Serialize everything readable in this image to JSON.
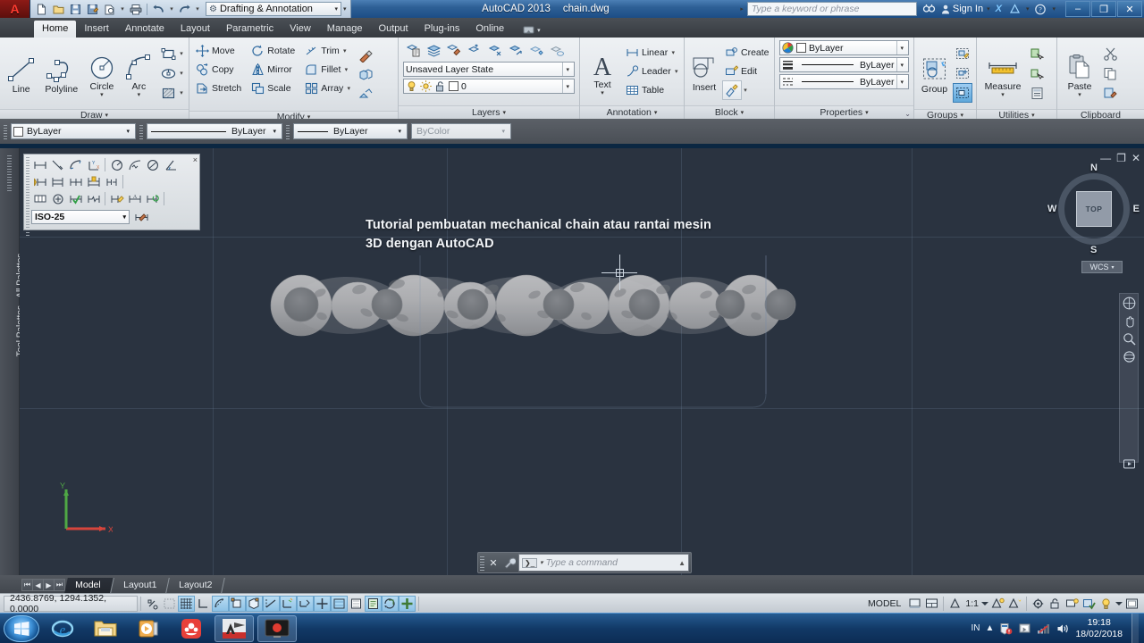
{
  "titlebar": {
    "app_icon": "autocad-a-icon",
    "quick_access": [
      {
        "name": "new-file",
        "glyph": "new-icon"
      },
      {
        "name": "open-file",
        "glyph": "open-icon"
      },
      {
        "name": "save-file",
        "glyph": "save-icon"
      },
      {
        "name": "save-as",
        "glyph": "saveas-icon"
      },
      {
        "name": "plot-preview",
        "glyph": "plotpreview-icon"
      },
      {
        "name": "plot",
        "glyph": "printer-icon"
      },
      {
        "name": "undo",
        "glyph": "undo-icon"
      },
      {
        "name": "redo",
        "glyph": "redo-icon"
      }
    ],
    "workspace": "Drafting & Annotation",
    "product": "AutoCAD 2013",
    "document": "chain.dwg",
    "search_placeholder": "Type a keyword or phrase",
    "signin": "Sign In",
    "exchange_label": "X",
    "window_buttons": {
      "minimize": "–",
      "restore": "❐",
      "close": "✕"
    }
  },
  "ribbon_tabs": [
    {
      "label": "Home",
      "active": true
    },
    {
      "label": "Insert",
      "active": false
    },
    {
      "label": "Annotate",
      "active": false
    },
    {
      "label": "Layout",
      "active": false
    },
    {
      "label": "Parametric",
      "active": false
    },
    {
      "label": "View",
      "active": false
    },
    {
      "label": "Manage",
      "active": false
    },
    {
      "label": "Output",
      "active": false
    },
    {
      "label": "Plug-ins",
      "active": false
    },
    {
      "label": "Online",
      "active": false
    }
  ],
  "panels": {
    "draw": {
      "title": "Draw",
      "buttons": [
        {
          "label": "Line",
          "icon": "line-icon"
        },
        {
          "label": "Polyline",
          "icon": "polyline-icon"
        },
        {
          "label": "Circle",
          "icon": "circle-icon"
        },
        {
          "label": "Arc",
          "icon": "arc-icon"
        }
      ],
      "side_icons": [
        "rectangle-icon",
        "ellipse-icon",
        "hatch-icon"
      ]
    },
    "modify": {
      "title": "Modify",
      "items": [
        {
          "label": "Move",
          "icon": "move-icon"
        },
        {
          "label": "Rotate",
          "icon": "rotate-icon"
        },
        {
          "label": "Trim",
          "icon": "trim-icon"
        },
        {
          "label": "Copy",
          "icon": "copy-icon"
        },
        {
          "label": "Mirror",
          "icon": "mirror-icon"
        },
        {
          "label": "Fillet",
          "icon": "fillet-icon"
        },
        {
          "label": "Stretch",
          "icon": "stretch-icon"
        },
        {
          "label": "Scale",
          "icon": "scale-icon"
        },
        {
          "label": "Array",
          "icon": "array-icon"
        }
      ],
      "side_icons": [
        "match-properties-icon",
        "3d-array-icon",
        "explode-icon"
      ]
    },
    "layers": {
      "title": "Layers",
      "top_icons": [
        "layer-properties-icon",
        "layer-set-icon",
        "layer-match-icon",
        "layer-previous-icon",
        "layer-isolate-icon",
        "layer-unisolate-icon",
        "layer-freeze-icon",
        "layer-off-icon"
      ],
      "layer_state": "Unsaved Layer State",
      "current_layer": "0",
      "layer_state_icons": [
        "lightbulb-icon",
        "sun-icon",
        "unlock-icon",
        "color-swatch-icon"
      ]
    },
    "annotation": {
      "title": "Annotation",
      "text_label": "Text",
      "items": [
        {
          "label": "Linear",
          "icon": "linear-dimension-icon"
        },
        {
          "label": "Leader",
          "icon": "leader-icon"
        },
        {
          "label": "Table",
          "icon": "table-icon"
        }
      ]
    },
    "block": {
      "title": "Block",
      "insert_label": "Insert",
      "items": [
        {
          "label": "Create",
          "icon": "create-block-icon"
        },
        {
          "label": "Edit",
          "icon": "edit-block-icon"
        }
      ],
      "attribute_icon": "define-attribute-icon"
    },
    "properties": {
      "title": "Properties",
      "color": "ByLayer",
      "linewidth": "ByLayer",
      "linetype": "ByLayer",
      "icons": [
        "color-wheel-icon",
        "lineweight-icon",
        "linetype-icon"
      ]
    },
    "groups": {
      "title": "Groups",
      "group_label": "Group",
      "side_icons": [
        "ungroup-icon",
        "group-edit-icon",
        "group-selection-on-icon"
      ]
    },
    "utilities": {
      "title": "Utilities",
      "measure_label": "Measure",
      "side_icons": [
        "quick-select-icon",
        "quick-calc-icon",
        "calculator-icon"
      ]
    },
    "clipboard": {
      "title": "Clipboard",
      "paste_label": "Paste",
      "side_icons": [
        "cut-icon",
        "copy-clip-icon",
        "paste-special-icon"
      ]
    }
  },
  "properties_toolbar": {
    "color": "ByLayer",
    "lineweight": "ByLayer",
    "linetype": "ByLayer",
    "plotstyle": "ByColor"
  },
  "dimension_toolbar": {
    "style": "ISO-25",
    "close_glyph": "×",
    "row1": [
      "linear-dimension-icon",
      "aligned-dimension-icon",
      "arc-length-icon",
      "ordinate-dimension-icon",
      "radius-dimension-icon",
      "jogged-dimension-icon",
      "diameter-dimension-icon",
      "angular-dimension-icon"
    ],
    "row2": [
      "quick-dimension-icon",
      "baseline-dimension-icon",
      "continue-dimension-icon",
      "dimension-space-icon",
      "dimension-break-icon"
    ],
    "row3": [
      "tolerance-icon",
      "center-mark-icon",
      "inspect-dimension-icon",
      "jogged-linear-icon",
      "dim-edit-icon",
      "dim-text-edit-icon",
      "dim-update-icon"
    ],
    "style_edit_icon": "dimension-style-icon"
  },
  "drawing": {
    "title_line1": "Tutorial pembuatan mechanical chain atau rantai mesin",
    "title_line2": "3D dengan AutoCAD",
    "model_name": "mechanical-chain-3d",
    "link_count": 6,
    "colors": {
      "background": "#2a3340",
      "chain_body": "#a8a9ac",
      "chain_shadow": "#7e8084",
      "pin_hole": "#6f7378",
      "crosshair": "#cfd8e2"
    }
  },
  "viewcube": {
    "face": "TOP",
    "north": "N",
    "east": "E",
    "south": "S",
    "west": "W",
    "ucs": "WCS"
  },
  "navbar_icons": [
    "full-navigation-wheel-icon",
    "pan-icon",
    "zoom-icon",
    "orbit-icon",
    "showmotion-icon"
  ],
  "palette_strip": {
    "label": "Tool Palettes - All Palettes"
  },
  "command_line": {
    "placeholder": "Type a command",
    "prompt_glyph": "❯_",
    "close_glyph": "✕",
    "settings_glyph": "wrench-icon",
    "expand_glyph": "▲"
  },
  "layout_tabs": {
    "nav": [
      "⏮",
      "◀",
      "▶",
      "⏭"
    ],
    "tabs": [
      {
        "label": "Model",
        "active": true
      },
      {
        "label": "Layout1",
        "active": false
      },
      {
        "label": "Layout2",
        "active": false
      }
    ]
  },
  "statusbar": {
    "coordinates": "2436.8769, 1294.1352, 0.0000",
    "left_icons": [
      {
        "name": "infer-constraints-icon",
        "on": false
      },
      {
        "name": "snap-mode-icon",
        "on": false
      },
      {
        "name": "grid-display-icon",
        "on": true
      },
      {
        "name": "ortho-mode-icon",
        "on": false
      },
      {
        "name": "polar-tracking-icon",
        "on": true
      },
      {
        "name": "object-snap-icon",
        "on": true
      },
      {
        "name": "3d-object-snap-icon",
        "on": true
      },
      {
        "name": "object-snap-tracking-icon",
        "on": true
      },
      {
        "name": "ucs-icon",
        "on": true
      },
      {
        "name": "dynamic-ucs-icon",
        "on": true
      },
      {
        "name": "dynamic-input-icon",
        "on": true
      },
      {
        "name": "lineweight-icon",
        "on": true
      },
      {
        "name": "transparency-icon",
        "on": true
      },
      {
        "name": "quick-properties-icon",
        "on": true
      },
      {
        "name": "selection-cycling-icon",
        "on": true
      },
      {
        "name": "annotation-monitor-icon",
        "on": true
      }
    ],
    "space_label": "MODEL",
    "annotation_scale": "1:1",
    "right_icons": [
      {
        "name": "model-space-icon"
      },
      {
        "name": "viewport-icon"
      },
      {
        "name": "annotation-scale-icon"
      },
      {
        "name": "annotation-visibility-icon"
      },
      {
        "name": "auto-scale-icon"
      },
      {
        "name": "workspace-switching-icon"
      },
      {
        "name": "toolbar-lock-icon"
      },
      {
        "name": "hardware-acceleration-icon"
      },
      {
        "name": "isolate-objects-icon"
      },
      {
        "name": "status-bar-menu-icon"
      },
      {
        "name": "clean-screen-icon"
      }
    ]
  },
  "taskbar": {
    "start": "start-orb-icon",
    "items": [
      {
        "name": "internet-explorer-icon",
        "running": false
      },
      {
        "name": "windows-explorer-icon",
        "running": false
      },
      {
        "name": "media-player-icon",
        "running": false
      },
      {
        "name": "gom-player-icon",
        "running": false
      },
      {
        "name": "autocad-icon",
        "running": true
      },
      {
        "name": "screen-recorder-icon",
        "running": true
      }
    ],
    "language": "IN",
    "tray": [
      "show-hidden-icons-icon",
      "security-icon",
      "action-center-icon",
      "network-icon",
      "volume-icon"
    ],
    "time": "19:18",
    "date": "18/02/2018"
  }
}
